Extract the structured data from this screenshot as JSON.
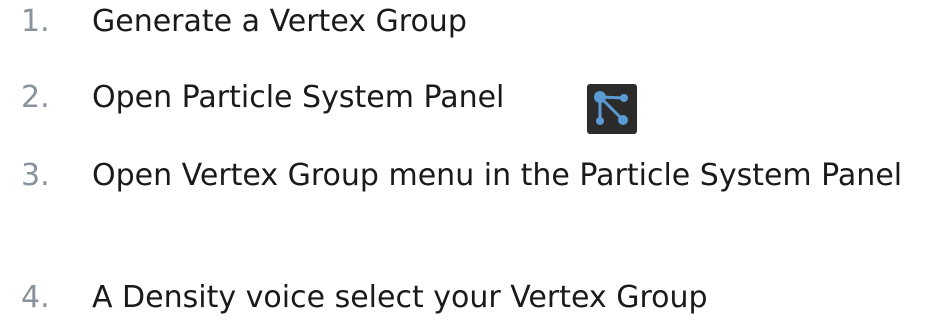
{
  "steps": [
    {
      "number": "1.",
      "text": "Generate a Vertex Group"
    },
    {
      "number": "2.",
      "text": "Open Particle System Panel"
    },
    {
      "number": "3.",
      "text": "Open Vertex Group menu in the Particle System Panel"
    },
    {
      "number": "4.",
      "text": "A Density voice select your Vertex Group"
    }
  ],
  "icons": {
    "particle_system": "particle-system-icon"
  },
  "colors": {
    "number": "#8a939b",
    "text": "#1a1a1a",
    "icon_bg": "#2b2b2b",
    "icon_fg": "#5b9bd5"
  }
}
